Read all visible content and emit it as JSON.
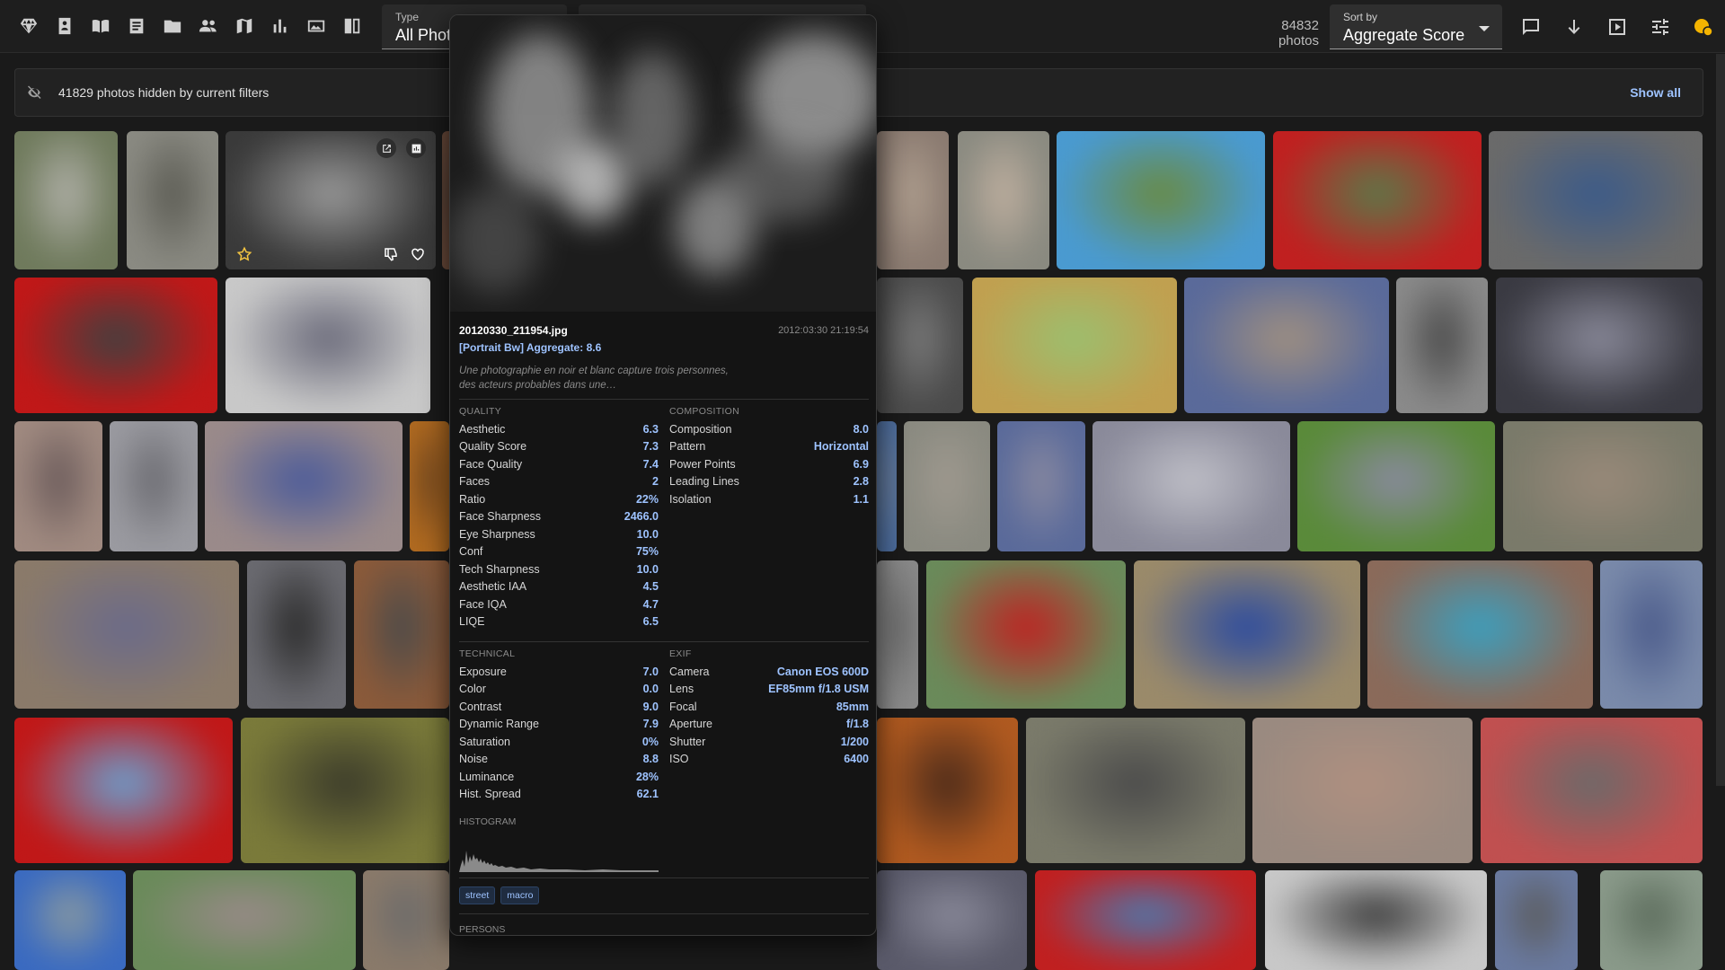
{
  "topbar": {
    "nav_icons": [
      "gem-icon",
      "portrait-icon",
      "book-icon",
      "notes-icon",
      "folder-icon",
      "people-icon",
      "map-icon",
      "stats-icon",
      "gallery-icon",
      "compare-icon"
    ],
    "filters": [
      {
        "label": "Type",
        "value": "All Phot"
      },
      {
        "label": "",
        "value": ""
      }
    ],
    "photo_count": "84832 photos",
    "sort": {
      "label": "Sort by",
      "value": "Aggregate Score"
    },
    "right_icons": [
      "comment-icon",
      "sort-direction-icon",
      "slideshow-icon",
      "tune-icon",
      "coins-icon"
    ]
  },
  "banner": {
    "text": "41829 photos hidden by current filters",
    "show_all": "Show all"
  },
  "popup": {
    "filename": "20120330_211954.jpg",
    "date": "2012:03:30 21:19:54",
    "title": "[Portrait Bw] Aggregate: 8.6",
    "description": "Une photographie en noir et blanc capture trois personnes, des acteurs probables dans une…",
    "quality": {
      "heading": "QUALITY",
      "rows": [
        {
          "k": "Aesthetic",
          "v": "6.3"
        },
        {
          "k": "Quality Score",
          "v": "7.3"
        },
        {
          "k": "Face Quality",
          "v": "7.4"
        },
        {
          "k": "Faces",
          "v": "2"
        },
        {
          "k": "Ratio",
          "v": "22%"
        },
        {
          "k": "Face Sharpness",
          "v": "2466.0"
        },
        {
          "k": "Eye Sharpness",
          "v": "10.0"
        },
        {
          "k": "Conf",
          "v": "75%"
        },
        {
          "k": "Tech Sharpness",
          "v": "10.0"
        },
        {
          "k": "Aesthetic IAA",
          "v": "4.5"
        },
        {
          "k": "Face IQA",
          "v": "4.7"
        },
        {
          "k": "LIQE",
          "v": "6.5"
        }
      ]
    },
    "composition": {
      "heading": "COMPOSITION",
      "rows": [
        {
          "k": "Composition",
          "v": "8.0"
        },
        {
          "k": "Pattern",
          "v": "Horizontal"
        },
        {
          "k": "Power Points",
          "v": "6.9"
        },
        {
          "k": "Leading Lines",
          "v": "2.8"
        },
        {
          "k": "Isolation",
          "v": "1.1"
        }
      ]
    },
    "technical": {
      "heading": "TECHNICAL",
      "rows": [
        {
          "k": "Exposure",
          "v": "7.0"
        },
        {
          "k": "Color",
          "v": "0.0"
        },
        {
          "k": "Contrast",
          "v": "9.0"
        },
        {
          "k": "Dynamic Range",
          "v": "7.9"
        },
        {
          "k": "Saturation",
          "v": "0%"
        },
        {
          "k": "Noise",
          "v": "8.8"
        },
        {
          "k": "Luminance",
          "v": "28%"
        },
        {
          "k": "Hist. Spread",
          "v": "62.1"
        }
      ]
    },
    "exif": {
      "heading": "EXIF",
      "rows": [
        {
          "k": "Camera",
          "v": "Canon EOS 600D"
        },
        {
          "k": "Lens",
          "v": "EF85mm f/1.8 USM"
        },
        {
          "k": "Focal",
          "v": "85mm"
        },
        {
          "k": "Aperture",
          "v": "f/1.8"
        },
        {
          "k": "Shutter",
          "v": "1/200"
        },
        {
          "k": "ISO",
          "v": "6400"
        }
      ]
    },
    "histogram_label": "HISTOGRAM",
    "tags": [
      "street",
      "macro"
    ],
    "persons_label": "PERSONS"
  },
  "colors": {
    "background": "#1a1a1a",
    "accent": "#9ec3ff",
    "star": "#f4c542",
    "coins": "#f4b400"
  }
}
